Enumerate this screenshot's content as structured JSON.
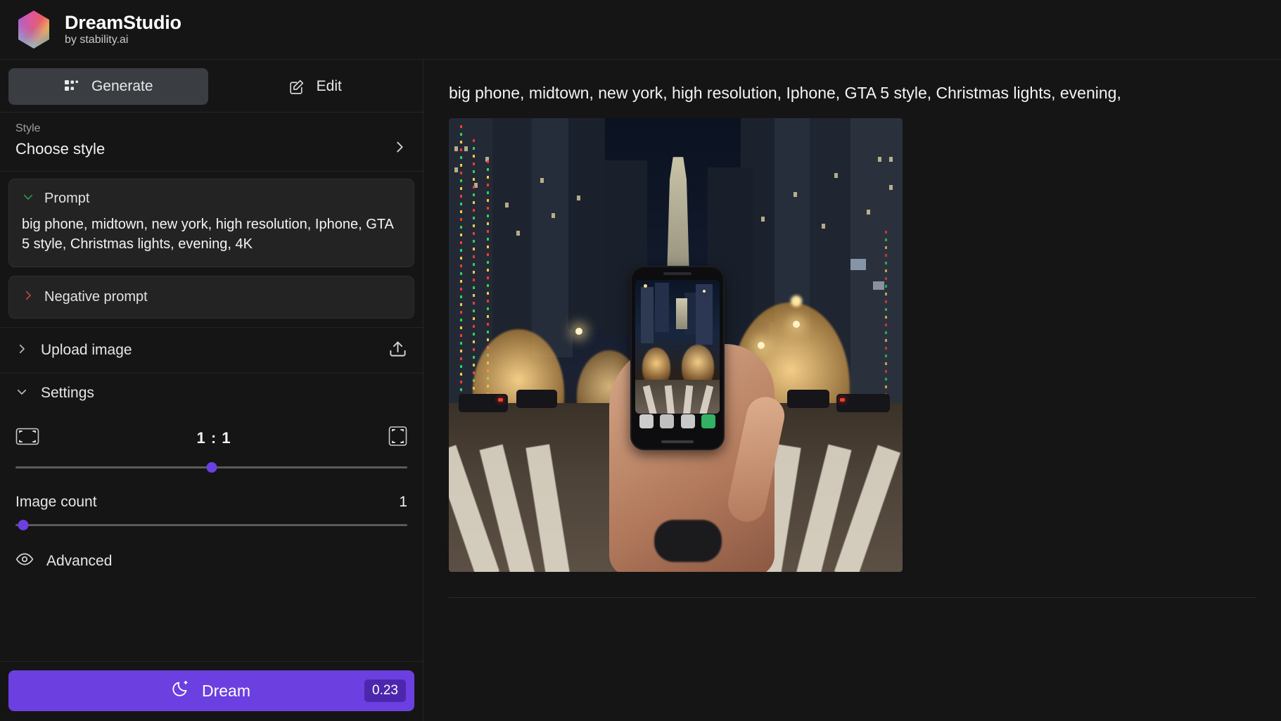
{
  "header": {
    "logo_icon": "hexagon-gradient-logo",
    "title": "DreamStudio",
    "subtitle": "by stability.ai"
  },
  "sidebar": {
    "tabs": [
      {
        "label": "Generate",
        "icon": "grid-icon",
        "active": true
      },
      {
        "label": "Edit",
        "icon": "pencil-square-icon",
        "active": false
      }
    ],
    "style": {
      "label": "Style",
      "value": "Choose style",
      "chevron_icon": "chevron-right-icon"
    },
    "prompt": {
      "title": "Prompt",
      "chevron_icon": "chevron-down-icon",
      "chevron_color": "#2f8f4e",
      "value": "big phone, midtown, new york, high resolution, Iphone, GTA 5 style, Christmas lights, evening, 4K"
    },
    "negative_prompt": {
      "title": "Negative prompt",
      "chevron_icon": "chevron-right-icon",
      "chevron_color": "#b24747",
      "value": ""
    },
    "upload_image": {
      "title": "Upload image",
      "chevron_icon": "chevron-right-icon",
      "action_icon": "upload-icon"
    },
    "settings": {
      "title": "Settings",
      "chevron_icon": "chevron-down-icon",
      "aspect_ratio": {
        "left_icon": "landscape-frame-icon",
        "right_icon": "portrait-frame-icon",
        "value": "1 : 1",
        "slider_percent": 50
      },
      "image_count": {
        "label": "Image count",
        "value": "1",
        "slider_percent": 2
      }
    },
    "advanced": {
      "label": "Advanced",
      "icon": "eye-icon"
    },
    "dream_button": {
      "label": "Dream",
      "icon": "moon-sparkle-icon",
      "cost": "0.23",
      "color": "#6c3fe0",
      "cost_badge_color": "#4b27ad"
    }
  },
  "main": {
    "prompt_display": "big phone, midtown, new york, high resolution, Iphone, GTA 5 style, Christmas lights, evening,",
    "result": {
      "alt": "generated image: hand holding a phone photographing a midtown New York street at night with Christmas lights and trees",
      "aspect": "1 : 1"
    }
  }
}
